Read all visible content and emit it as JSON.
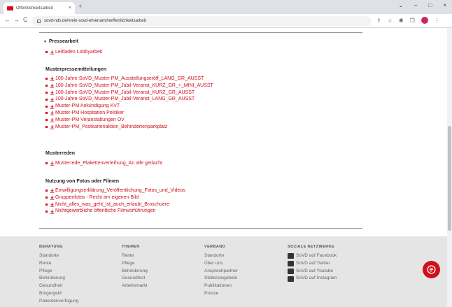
{
  "browser": {
    "tab_title": "Öffentlichkeitsarbeit",
    "tab_close": "×",
    "new_tab": "+",
    "url": "sovd-nds.de/mein-sovd-ehrenamt/oeffentlichkeitsarbeit",
    "back": "←",
    "forward": "→",
    "reload": "C",
    "win_min": "–",
    "win_max": "□",
    "win_close": "×",
    "win_chevron": "⌄",
    "share": "⇪",
    "star": "☆",
    "extensions": "✱",
    "sidepanel": "❐",
    "menu": "⋮"
  },
  "page": {
    "accent_color": "#d0101c",
    "press_section": {
      "title": "Pressearbeit",
      "toggle": "▼",
      "links": [
        "Leitfaden Lobbyarbeit"
      ]
    },
    "groups": [
      {
        "heading": "Musterpressemitteilungen",
        "links": [
          "100-Jahre-SoVD_Muster-PM_Ausstellungseröff_LANG_GR_AUSST",
          "100-Jahre-SoVD_Muster-PM_Jubil-Veranst_KURZ_GR_+_MINI_AUSST",
          "100-Jahre-SoVD_Muster-PM_Jubil-Veranst_KURZ_GR_AUSST",
          "100-Jahre-SoVD_Muster-PM_Jubil-Veranst_LANG_GR_AUSST",
          "Muster-PM Ankündigung KVT",
          "Muster-PM Hospitation Politiker",
          "Muster-PM Veranstaltungen OV",
          "Muster-PM_Postkartenaktion_Behindertenparkplatz"
        ]
      },
      {
        "heading": "Musterreden",
        "links": [
          "Musterrede_Plakettenverleihung_An alle gedacht"
        ]
      },
      {
        "heading": "Nutzung von Fotos oder Filmen",
        "links": [
          "Einwilligungserklärung_Veröffentlichung_Fotos_und_Videos",
          "Gruppenfotos - Recht am eigenen Bild",
          "Nicht_alles_was_geht_ist_auch_erlaubt_Broschuere",
          "Nichtgewerbliche öffentliche Filmvorführungen"
        ]
      }
    ]
  },
  "footer": {
    "columns": [
      {
        "title": "BERATUNG",
        "items": [
          "Standorte",
          "Rente",
          "Pflege",
          "Behinderung",
          "Gesundheit",
          "Bürgergeld",
          "Patientenverfügung"
        ]
      },
      {
        "title": "THEMEN",
        "items": [
          "Rente",
          "Pflege",
          "Behinderung",
          "Gesundheit",
          "Arbeitsmarkt"
        ]
      },
      {
        "title": "VERBAND",
        "items": [
          "Standorte",
          "Über uns",
          "Ansprechpartner",
          "Stellenangebote",
          "Publikationen",
          "Presse"
        ]
      },
      {
        "title": "SOZIALE NETZWERKE",
        "items": [
          "SoVD auf Facebook",
          "SoVD auf Twitter",
          "SoVD auf Youtube",
          "SoVD auf Instagram"
        ],
        "icons": [
          "facebook-icon",
          "twitter-icon",
          "youtube-icon",
          "instagram-icon"
        ]
      }
    ]
  }
}
